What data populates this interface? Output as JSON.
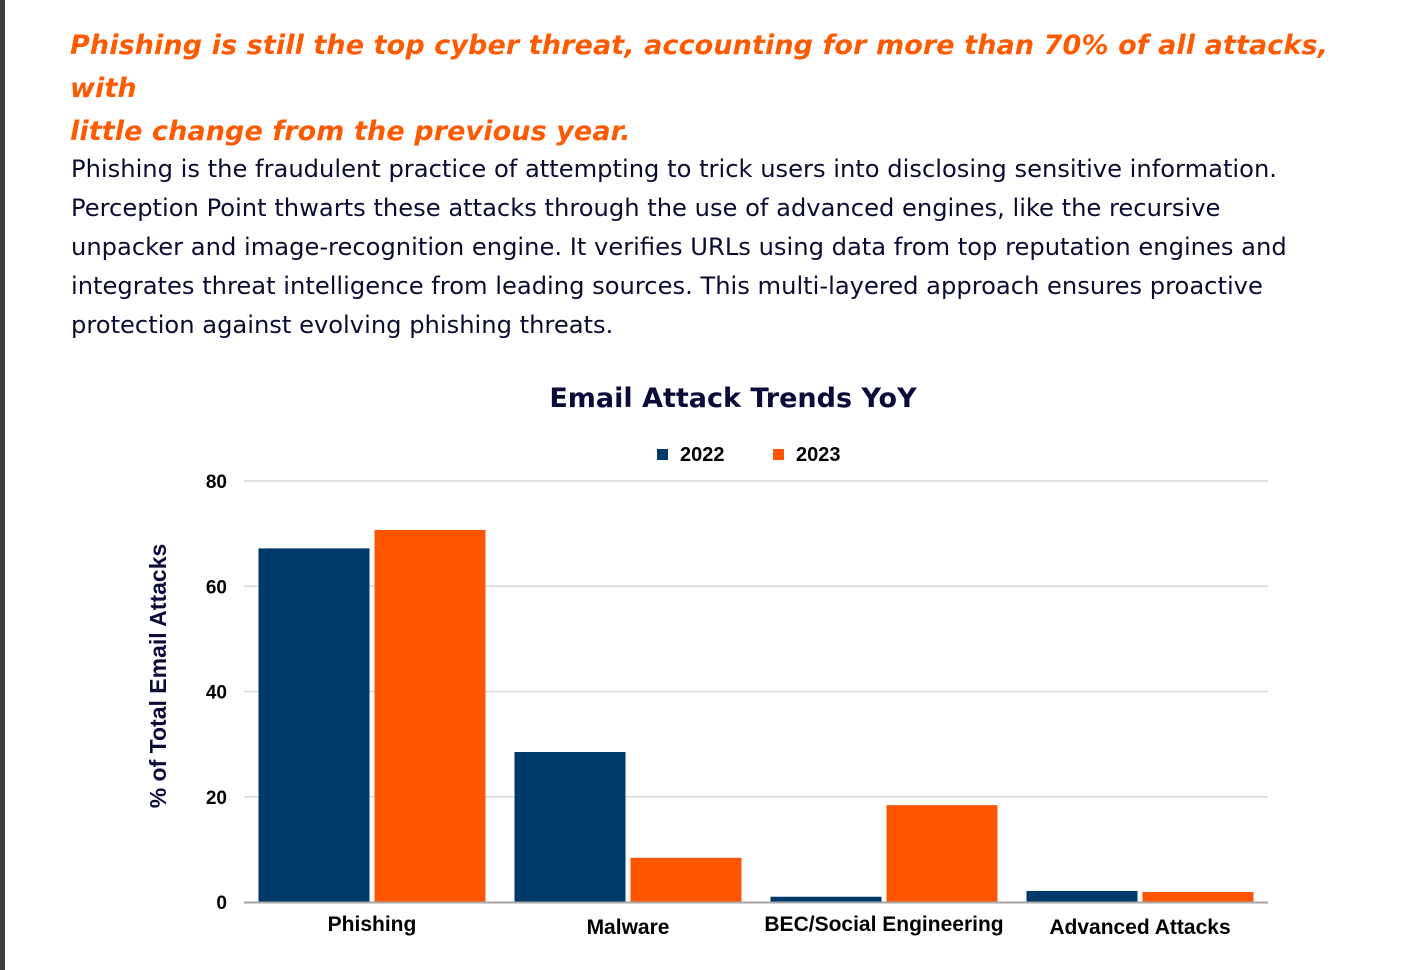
{
  "headline": {
    "lines": [
      "Phishing is still the top cyber threat, accounting for more than 70% of all attacks, with",
      "little change from the previous year."
    ]
  },
  "paragraph": {
    "lines": [
      "Phishing is the fraudulent practice of attempting to trick users into disclosing sensitive information.",
      "Perception Point thwarts these attacks through the use of advanced engines, like the recursive",
      "unpacker and image-recognition engine. It verifies URLs using data from top reputation engines and",
      "integrates threat intelligence from leading sources. This multi-layered approach ensures proactive",
      "protection against evolving phishing threats."
    ]
  },
  "colors": {
    "series_2022": "#003a6b",
    "series_2023": "#ff5500",
    "gridline": "#d9d9d9",
    "baseline": "#a6a6a6"
  },
  "chart_data": {
    "type": "bar",
    "title": "Email Attack Trends YoY",
    "xlabel": "",
    "ylabel": "% of Total Email Attacks",
    "categories": [
      "Phishing",
      "Malware",
      "BEC/Social Engineering",
      "Advanced Attacks"
    ],
    "series": [
      {
        "name": "2022",
        "values": [
          67.2,
          28.5,
          1.0,
          2.1
        ]
      },
      {
        "name": "2023",
        "values": [
          70.7,
          8.4,
          18.4,
          1.9
        ]
      }
    ],
    "ylim": [
      0,
      80
    ],
    "yticks": [
      0,
      20,
      40,
      60,
      80
    ],
    "grid": true,
    "legend": "top-center"
  }
}
